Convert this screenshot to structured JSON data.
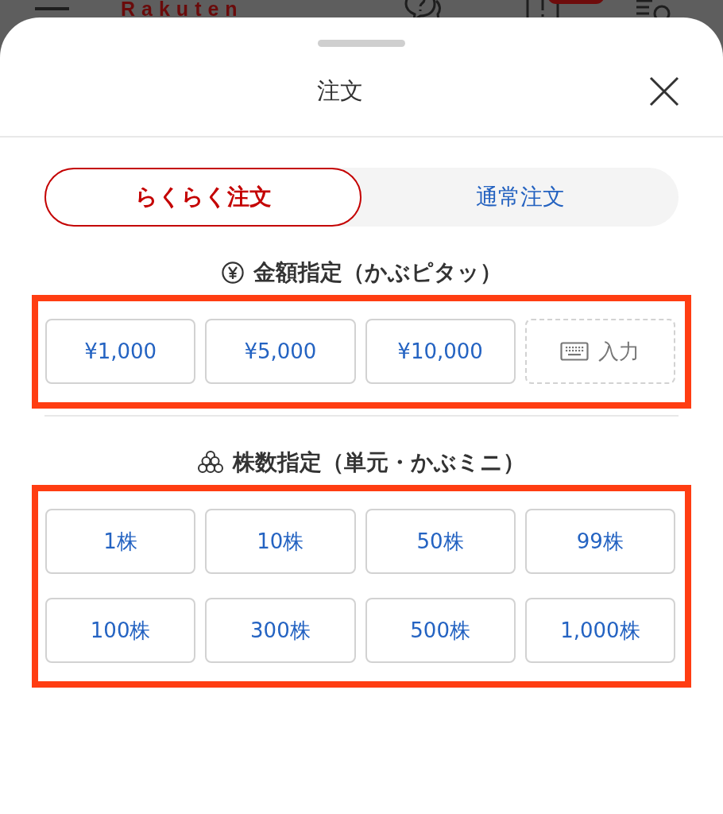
{
  "background_header": {
    "logo": "Rakuten"
  },
  "sheet": {
    "title": "注文"
  },
  "order_tabs": [
    {
      "label": "らくらく注文",
      "selected": true
    },
    {
      "label": "通常注文",
      "selected": false
    }
  ],
  "sections": [
    {
      "kind": "amount",
      "heading": "金額指定（かぶピタッ）",
      "highlighted": true,
      "options": [
        {
          "kind": "preset",
          "label": "¥1,000"
        },
        {
          "kind": "preset",
          "label": "¥5,000"
        },
        {
          "kind": "preset",
          "label": "¥10,000"
        },
        {
          "kind": "input",
          "label": "入力"
        }
      ]
    },
    {
      "kind": "shares",
      "heading": "株数指定（単元・かぶミニ）",
      "highlighted": true,
      "options": [
        {
          "kind": "preset",
          "label": "1株"
        },
        {
          "kind": "preset",
          "label": "10株"
        },
        {
          "kind": "preset",
          "label": "50株"
        },
        {
          "kind": "preset",
          "label": "99株"
        },
        {
          "kind": "preset",
          "label": "100株"
        },
        {
          "kind": "preset",
          "label": "300株"
        },
        {
          "kind": "preset",
          "label": "500株"
        },
        {
          "kind": "preset",
          "label": "1,000株"
        }
      ]
    }
  ]
}
